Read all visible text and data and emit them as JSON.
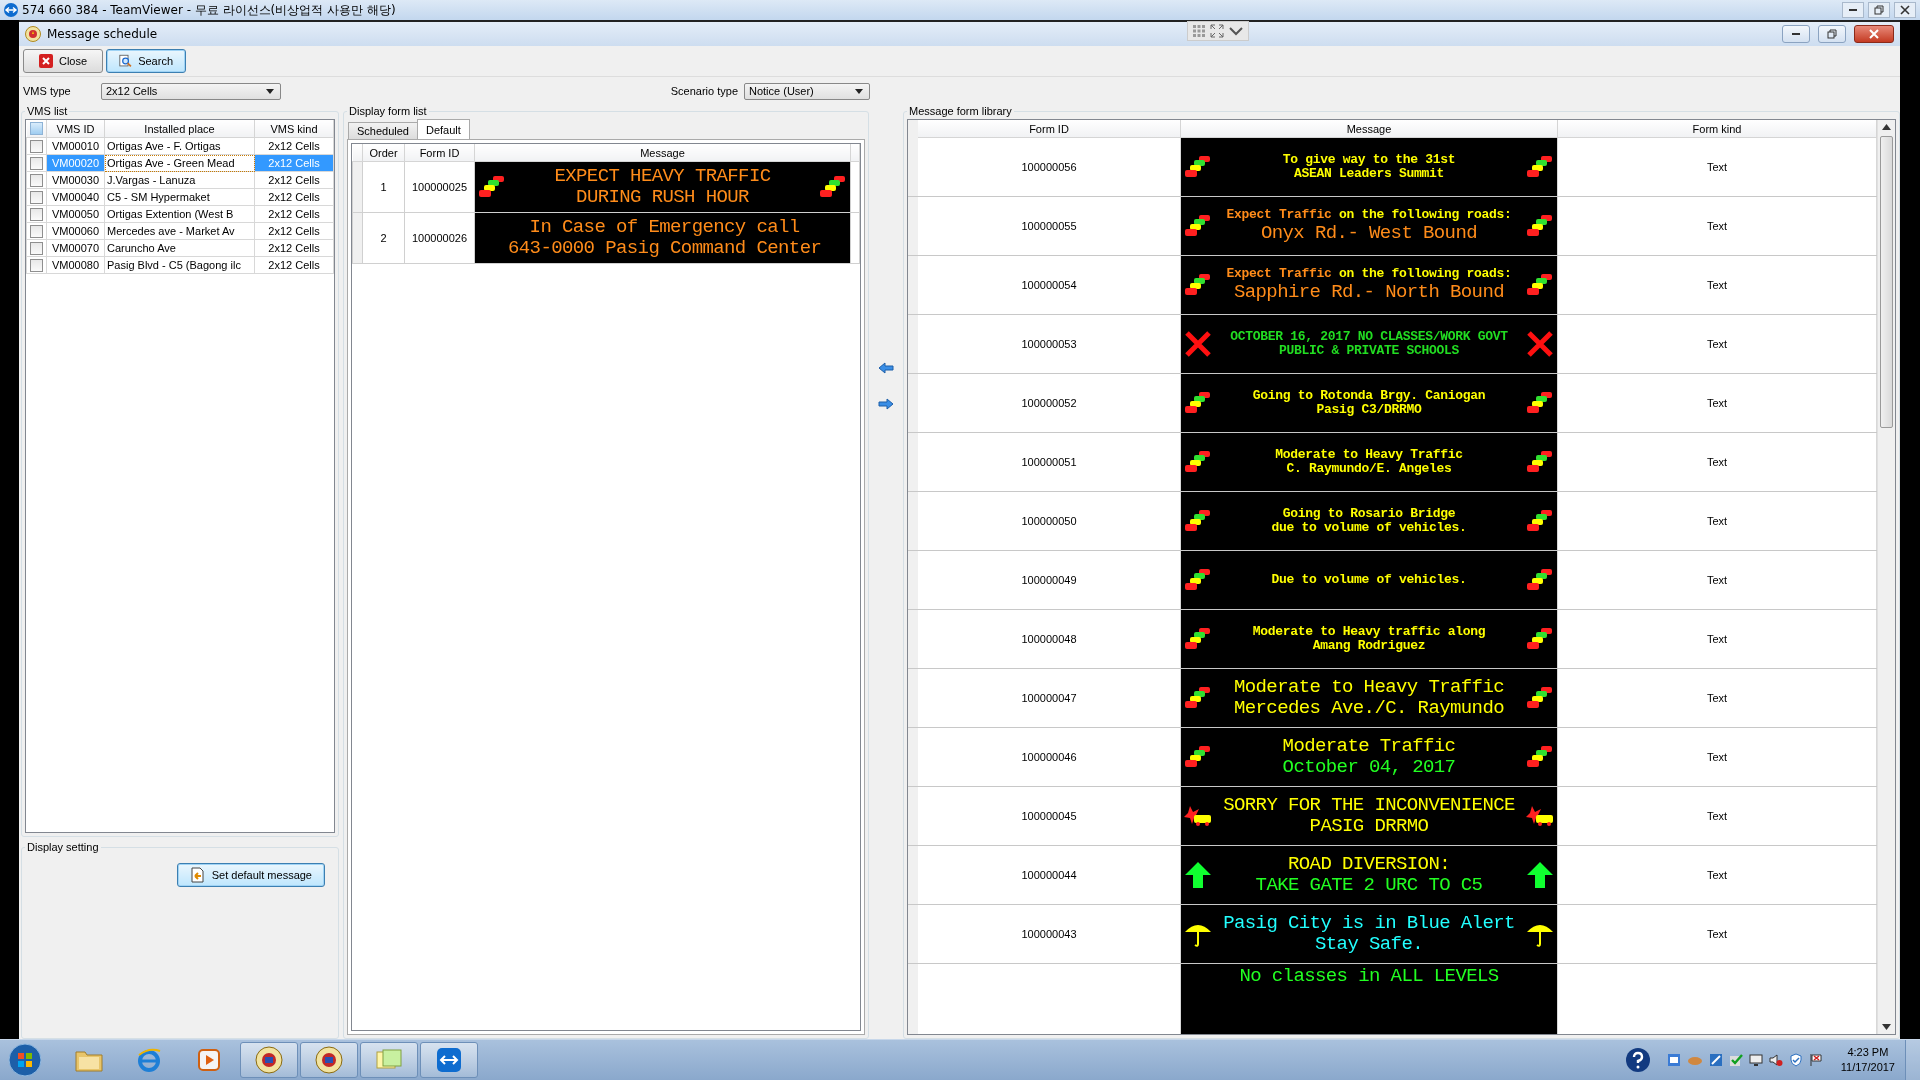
{
  "remote_window": {
    "title": "574 660 384 - TeamViewer - 무료 라이선스(비상업적 사용만 해당)"
  },
  "window": {
    "title": "Message schedule"
  },
  "toolbar": [
    {
      "label": "Close",
      "kind": "close"
    },
    {
      "label": "Search",
      "kind": "search"
    }
  ],
  "vms_type": {
    "label": "VMS type",
    "value": "2x12 Cells"
  },
  "scenario_type": {
    "label": "Scenario type",
    "value": "Notice (User)"
  },
  "vms_list": {
    "title": "VMS list",
    "select_all": {
      "checked": false
    },
    "columns": [
      "VMS ID",
      "Installed place",
      "VMS kind"
    ],
    "rows": [
      {
        "id": "VM00010",
        "place": "Ortigas Ave - F. Ortigas",
        "vms_kind": "2x12 Cells",
        "checked": false,
        "selected": false
      },
      {
        "id": "VM00020",
        "place": "Ortigas Ave - Green Mead",
        "vms_kind": "2x12 Cells",
        "checked": false,
        "selected": true
      },
      {
        "id": "VM00030",
        "place": "J.Vargas - Lanuza",
        "vms_kind": "2x12 Cells",
        "checked": false,
        "selected": false
      },
      {
        "id": "VM00040",
        "place": "C5 - SM Hypermaket",
        "vms_kind": "2x12 Cells",
        "checked": false,
        "selected": false
      },
      {
        "id": "VM00050",
        "place": "Ortigas Extention (West B",
        "vms_kind": "2x12 Cells",
        "checked": false,
        "selected": false
      },
      {
        "id": "VM00060",
        "place": "Mercedes ave - Market Av",
        "vms_kind": "2x12 Cells",
        "checked": false,
        "selected": false
      },
      {
        "id": "VM00070",
        "place": "Caruncho Ave",
        "vms_kind": "2x12 Cells",
        "checked": false,
        "selected": false
      },
      {
        "id": "VM00080",
        "place": "Pasig Blvd - C5 (Bagong ilc",
        "vms_kind": "2x12 Cells",
        "checked": false,
        "selected": false
      }
    ]
  },
  "display_setting": {
    "title": "Display setting",
    "button": "Set default message"
  },
  "display_form_list": {
    "title": "Display form list",
    "tabs": [
      {
        "label": "Scheduled",
        "selected": false
      },
      {
        "label": "Default",
        "selected": true
      }
    ],
    "columns": [
      "Order",
      "Form ID",
      "Message"
    ],
    "rows": [
      {
        "order": "1",
        "form_id": "100000025",
        "kind": "car",
        "lines": [
          {
            "kind": "big",
            "parts": [
              {
                "text": "EXPECT HEAVY TRAFFIC",
                "color": "#ff8c1a"
              }
            ]
          },
          {
            "kind": "big",
            "parts": [
              {
                "text": "DURING RUSH HOUR",
                "color": "#ff8c1a"
              }
            ]
          }
        ]
      },
      {
        "order": "2",
        "form_id": "100000026",
        "kind": "plain",
        "lines": [
          {
            "kind": "big",
            "parts": [
              {
                "text": "In Case of Emergency call",
                "color": "#ff8c1a"
              }
            ]
          },
          {
            "kind": "big",
            "parts": [
              {
                "text": "643-0000 Pasig Command Center",
                "color": "#ff8c1a"
              }
            ]
          }
        ]
      }
    ]
  },
  "library": {
    "title": "Message form library",
    "columns": [
      "Form ID",
      "Message",
      "Form kind"
    ],
    "rows": [
      {
        "form_id": "100000056",
        "kind": "car",
        "form_kind": "Text",
        "lines": [
          {
            "kind": "small",
            "parts": [
              {
                "text": "To give way to the 31st",
                "color": "#ffff00"
              }
            ]
          },
          {
            "kind": "small",
            "parts": [
              {
                "text": "ASEAN Leaders Summit",
                "color": "#ffff00"
              }
            ]
          }
        ]
      },
      {
        "form_id": "100000055",
        "kind": "car",
        "form_kind": "Text",
        "lines": [
          {
            "kind": "small",
            "parts": [
              {
                "text": "Expect Traffic",
                "color": "#ff8c1a"
              },
              {
                "text": " on the following roads:",
                "color": "#ffff00"
              }
            ]
          },
          {
            "kind": "big",
            "parts": [
              {
                "text": "Onyx Rd.- West Bound",
                "color": "#ff8c1a"
              }
            ]
          }
        ]
      },
      {
        "form_id": "100000054",
        "kind": "car",
        "form_kind": "Text",
        "lines": [
          {
            "kind": "small",
            "parts": [
              {
                "text": "Expect Traffic",
                "color": "#ff8c1a"
              },
              {
                "text": " on the following roads:",
                "color": "#ffff00"
              }
            ]
          },
          {
            "kind": "big",
            "parts": [
              {
                "text": "Sapphire Rd.- North Bound",
                "color": "#ff8c1a"
              }
            ]
          }
        ]
      },
      {
        "form_id": "100000053",
        "kind": "cross",
        "form_kind": "Text",
        "lines": [
          {
            "kind": "small",
            "parts": [
              {
                "text": "OCTOBER 16, 2017 NO CLASSES/WORK GOVT",
                "color": "#22dd22"
              }
            ]
          },
          {
            "kind": "small",
            "parts": [
              {
                "text": "PUBLIC & PRIVATE SCHOOLS",
                "color": "#22dd22"
              }
            ]
          }
        ]
      },
      {
        "form_id": "100000052",
        "kind": "car",
        "form_kind": "Text",
        "lines": [
          {
            "kind": "small",
            "parts": [
              {
                "text": "Going to Rotonda Brgy. Caniogan",
                "color": "#ffff00"
              }
            ]
          },
          {
            "kind": "small",
            "parts": [
              {
                "text": "Pasig C3/DRRMO",
                "color": "#ffff00"
              }
            ]
          }
        ]
      },
      {
        "form_id": "100000051",
        "kind": "car",
        "form_kind": "Text",
        "lines": [
          {
            "kind": "small",
            "parts": [
              {
                "text": "Moderate to Heavy Traffic",
                "color": "#ffff00"
              }
            ]
          },
          {
            "kind": "small",
            "parts": [
              {
                "text": "C. Raymundo/E. Angeles",
                "color": "#ffff00"
              }
            ]
          }
        ]
      },
      {
        "form_id": "100000050",
        "kind": "car",
        "form_kind": "Text",
        "lines": [
          {
            "kind": "small",
            "parts": [
              {
                "text": "Going to Rosario Bridge",
                "color": "#ffff00"
              }
            ]
          },
          {
            "kind": "small",
            "parts": [
              {
                "text": "due to volume of vehicles.",
                "color": "#ffff00"
              }
            ]
          }
        ]
      },
      {
        "form_id": "100000049",
        "kind": "car",
        "form_kind": "Text",
        "lines": [
          {
            "kind": "small",
            "parts": [
              {
                "text": "Due to volume of vehicles.",
                "color": "#ffff00"
              }
            ]
          }
        ]
      },
      {
        "form_id": "100000048",
        "kind": "car",
        "form_kind": "Text",
        "lines": [
          {
            "kind": "small",
            "parts": [
              {
                "text": "Moderate to Heavy traffic along",
                "color": "#ffff00"
              }
            ]
          },
          {
            "kind": "small",
            "parts": [
              {
                "text": "Amang Rodriguez",
                "color": "#ffff00"
              }
            ]
          }
        ]
      },
      {
        "form_id": "100000047",
        "kind": "car",
        "form_kind": "Text",
        "lines": [
          {
            "kind": "big",
            "parts": [
              {
                "text": "Moderate to Heavy Traffic",
                "color": "#ffff00"
              }
            ]
          },
          {
            "kind": "big",
            "parts": [
              {
                "text": "Mercedes Ave./C. Raymundo",
                "color": "#ffff00"
              }
            ]
          }
        ]
      },
      {
        "form_id": "100000046",
        "kind": "car",
        "form_kind": "Text",
        "lines": [
          {
            "kind": "big",
            "parts": [
              {
                "text": "Moderate Traffic",
                "color": "#ffff00"
              }
            ]
          },
          {
            "kind": "big",
            "parts": [
              {
                "text": "October 04, 2017",
                "color": "#22ff22"
              }
            ]
          }
        ]
      },
      {
        "form_id": "100000045",
        "kind": "crash",
        "form_kind": "Text",
        "lines": [
          {
            "kind": "big",
            "parts": [
              {
                "text": "SORRY FOR THE INCONVENIENCE",
                "color": "#ffff00"
              }
            ]
          },
          {
            "kind": "big",
            "parts": [
              {
                "text": "PASIG DRRMO",
                "color": "#ffff00"
              }
            ]
          }
        ]
      },
      {
        "form_id": "100000044",
        "kind": "arrow",
        "form_kind": "Text",
        "lines": [
          {
            "kind": "big",
            "parts": [
              {
                "text": "ROAD DIVERSION:",
                "color": "#ffff00"
              }
            ]
          },
          {
            "kind": "big",
            "parts": [
              {
                "text": "TAKE GATE 2 URC TO C5",
                "color": "#22ff22"
              }
            ]
          }
        ]
      },
      {
        "form_id": "100000043",
        "kind": "umbrella",
        "form_kind": "Text",
        "lines": [
          {
            "kind": "big",
            "parts": [
              {
                "text": "Pasig City is in Blue Alert",
                "color": "#22ffff"
              }
            ]
          },
          {
            "kind": "big",
            "parts": [
              {
                "text": "Stay Safe.",
                "color": "#22ffff"
              }
            ]
          }
        ]
      },
      {
        "kind": "plain",
        "lines": [
          {
            "kind": "big",
            "parts": [
              {
                "text": "No classes in ALL LEVELS",
                "color": "#22ff22"
              }
            ]
          }
        ]
      }
    ]
  },
  "taskbar": {
    "apps": [
      {
        "kind": "folder",
        "open": false
      },
      {
        "kind": "browser",
        "open": false
      },
      {
        "kind": "player",
        "open": false
      },
      {
        "kind": "emblem",
        "open": true
      },
      {
        "kind": "emblem",
        "open": true
      },
      {
        "kind": "notes",
        "open": true
      },
      {
        "kind": "remote",
        "open": true
      }
    ],
    "time": "4:23 PM",
    "date": "11/17/2017"
  }
}
